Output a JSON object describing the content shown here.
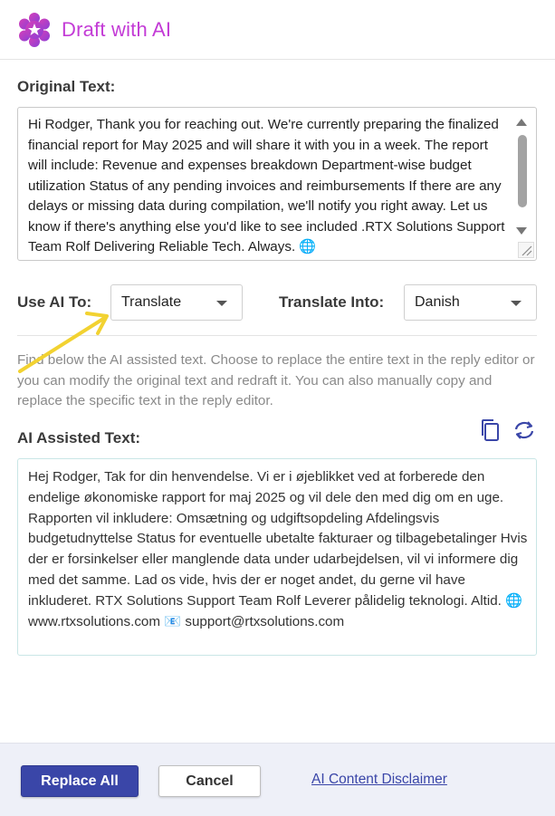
{
  "header": {
    "title": "Draft with AI",
    "logo_icon": "flower-logo-icon",
    "brand_color": "#c33bd6"
  },
  "original": {
    "label": "Original Text:",
    "text": "Hi Rodger, Thank you for reaching out. We're currently preparing the finalized financial report for May 2025 and will share it with you in a week. The report will include: Revenue and expenses breakdown Department-wise budget utilization Status of any pending invoices and reimbursements If there are any delays or missing data during compilation, we'll notify you right away. Let us know if there's anything else you'd like to see included .RTX Solutions Support Team Rolf Delivering Reliable Tech. Always. 🌐"
  },
  "controls": {
    "use_ai_label": "Use AI To:",
    "use_ai_value": "Translate",
    "translate_into_label": "Translate Into:",
    "translate_into_value": "Danish"
  },
  "info": {
    "text": "Find below the AI assisted text. Choose to replace the entire text in the reply editor or you can modify the original text and redraft it. You can also manually copy and replace the specific text in the reply editor."
  },
  "ai": {
    "label": "AI Assisted Text:",
    "text": "Hej Rodger, Tak for din henvendelse. Vi er i øjeblikket ved at forberede den endelige økonomiske rapport for maj 2025 og vil dele den med dig om en uge. Rapporten vil inkludere: Omsætning og udgiftsopdeling Afdelingsvis budgetudnyttelse Status for eventuelle ubetalte fakturaer og tilbagebetalinger Hvis der er forsinkelser eller manglende data under udarbejdelsen, vil vi informere dig med det samme. Lad os vide, hvis der er noget andet, du gerne vil have inkluderet. RTX Solutions Support Team Rolf Leverer pålidelig teknologi. Altid. 🌐 www.rtxsolutions.com 📧 support@rtxsolutions.com",
    "copy_icon": "copy-icon",
    "refresh_icon": "refresh-icon"
  },
  "footer": {
    "replace_all_label": "Replace All",
    "cancel_label": "Cancel",
    "disclaimer_label": "AI Content Disclaimer"
  },
  "colors": {
    "accent": "#3a46a8",
    "annotation_arrow": "#f2d231"
  }
}
